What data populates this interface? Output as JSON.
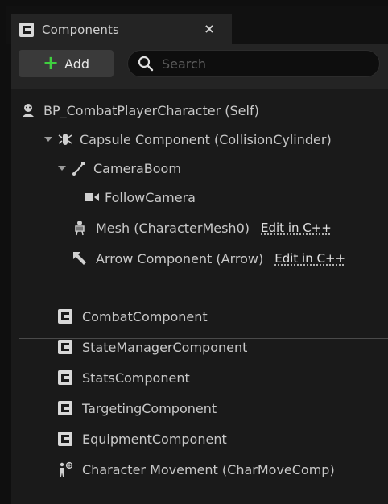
{
  "tab": {
    "title": "Components",
    "close_glyph": "×"
  },
  "toolbar": {
    "add_label": "Add",
    "add_glyph": "+",
    "search_placeholder": "Search"
  },
  "tree": {
    "root": {
      "label": "BP_CombatPlayerCharacter (Self)",
      "icon": "character-icon"
    },
    "items": [
      {
        "label": "Capsule Component (CollisionCylinder)",
        "icon": "capsule-icon",
        "expanded": true
      },
      {
        "label": "CameraBoom",
        "icon": "spring-arm-icon",
        "expanded": true
      },
      {
        "label": "FollowCamera",
        "icon": "camera-icon"
      },
      {
        "label": "Mesh (CharacterMesh0)",
        "icon": "skeletal-mesh-icon",
        "edit_link": "Edit in C++"
      },
      {
        "label": "Arrow Component (Arrow)",
        "icon": "arrow-icon",
        "edit_link": "Edit in C++"
      }
    ],
    "actor_components": [
      {
        "label": "CombatComponent",
        "icon": "component-icon"
      },
      {
        "label": "StateManagerComponent",
        "icon": "component-icon"
      },
      {
        "label": "StatsComponent",
        "icon": "component-icon"
      },
      {
        "label": "TargetingComponent",
        "icon": "component-icon"
      },
      {
        "label": "EquipmentComponent",
        "icon": "component-icon"
      },
      {
        "label": "Character Movement (CharMoveComp)",
        "icon": "character-movement-icon"
      }
    ]
  },
  "colors": {
    "panel_bg": "#1a1a1a",
    "toolbar_bg": "#242424",
    "add_plus": "#3fcf3f",
    "text": "#c8c8c8"
  }
}
